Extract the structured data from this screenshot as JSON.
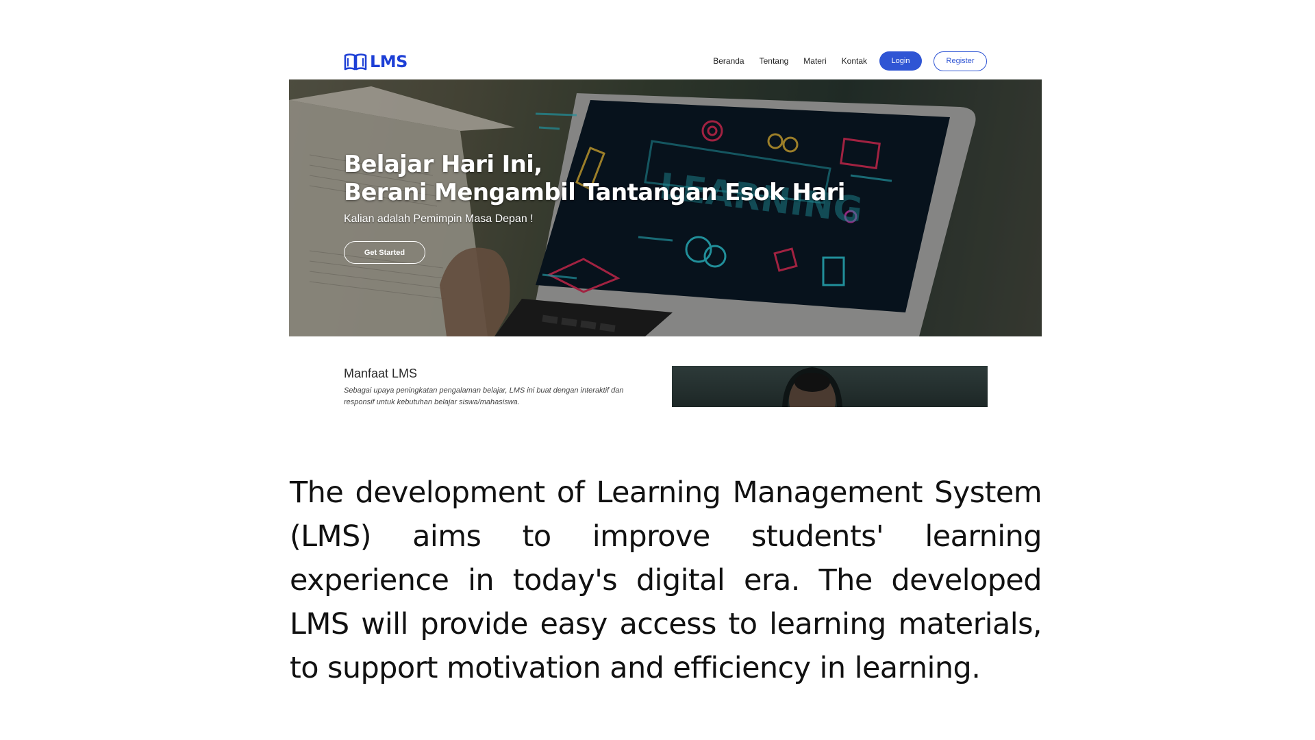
{
  "site": {
    "logo_text": "LMS",
    "nav": {
      "links": [
        "Beranda",
        "Tentang",
        "Materi",
        "Kontak"
      ],
      "login_label": "Login",
      "register_label": "Register"
    },
    "hero": {
      "title_line1": "Belajar Hari Ini,",
      "title_line2": "Berani Mengambil Tantangan Esok Hari",
      "subtitle": "Kalian adalah Pemimpin Masa Depan !",
      "cta_label": "Get Started",
      "screen_word": "LEARNING"
    },
    "benefit": {
      "title": "Manfaat LMS",
      "description": "Sebagai upaya peningkatan pengalaman belajar, LMS ini buat dengan interaktif dan responsif untuk kebutuhan belajar siswa/mahasiswa."
    }
  },
  "caption": "The development of Learning Management System (LMS) aims to improve students' learning experience in today's digital era. The developed LMS will provide easy access to learning materials, to support motivation and efficiency in learning.",
  "colors": {
    "brand_blue": "#1d3fd6",
    "button_blue": "#2f55d4",
    "neon_cyan": "#2ec7d6",
    "neon_red": "#e0305a",
    "neon_yellow": "#d9b13a"
  }
}
